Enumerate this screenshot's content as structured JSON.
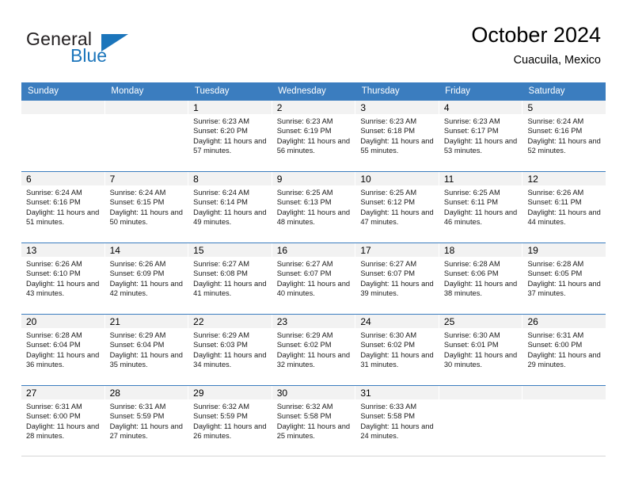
{
  "brand": {
    "name_top": "General",
    "name_bottom": "Blue",
    "triangle_icon": "blue-triangle-icon",
    "accent_color": "#1b75bb"
  },
  "header": {
    "title": "October 2024",
    "subtitle": "Cuacuila, Mexico"
  },
  "calendar": {
    "header_color": "#3b7dbf",
    "weekdays": [
      "Sunday",
      "Monday",
      "Tuesday",
      "Wednesday",
      "Thursday",
      "Friday",
      "Saturday"
    ],
    "labels": {
      "sunrise": "Sunrise:",
      "sunset": "Sunset:",
      "daylight": "Daylight:"
    },
    "weeks": [
      [
        {
          "day": "",
          "sunrise": "",
          "sunset": "",
          "daylight": ""
        },
        {
          "day": "",
          "sunrise": "",
          "sunset": "",
          "daylight": ""
        },
        {
          "day": "1",
          "sunrise": "Sunrise: 6:23 AM",
          "sunset": "Sunset: 6:20 PM",
          "daylight": "Daylight: 11 hours and 57 minutes."
        },
        {
          "day": "2",
          "sunrise": "Sunrise: 6:23 AM",
          "sunset": "Sunset: 6:19 PM",
          "daylight": "Daylight: 11 hours and 56 minutes."
        },
        {
          "day": "3",
          "sunrise": "Sunrise: 6:23 AM",
          "sunset": "Sunset: 6:18 PM",
          "daylight": "Daylight: 11 hours and 55 minutes."
        },
        {
          "day": "4",
          "sunrise": "Sunrise: 6:23 AM",
          "sunset": "Sunset: 6:17 PM",
          "daylight": "Daylight: 11 hours and 53 minutes."
        },
        {
          "day": "5",
          "sunrise": "Sunrise: 6:24 AM",
          "sunset": "Sunset: 6:16 PM",
          "daylight": "Daylight: 11 hours and 52 minutes."
        }
      ],
      [
        {
          "day": "6",
          "sunrise": "Sunrise: 6:24 AM",
          "sunset": "Sunset: 6:16 PM",
          "daylight": "Daylight: 11 hours and 51 minutes."
        },
        {
          "day": "7",
          "sunrise": "Sunrise: 6:24 AM",
          "sunset": "Sunset: 6:15 PM",
          "daylight": "Daylight: 11 hours and 50 minutes."
        },
        {
          "day": "8",
          "sunrise": "Sunrise: 6:24 AM",
          "sunset": "Sunset: 6:14 PM",
          "daylight": "Daylight: 11 hours and 49 minutes."
        },
        {
          "day": "9",
          "sunrise": "Sunrise: 6:25 AM",
          "sunset": "Sunset: 6:13 PM",
          "daylight": "Daylight: 11 hours and 48 minutes."
        },
        {
          "day": "10",
          "sunrise": "Sunrise: 6:25 AM",
          "sunset": "Sunset: 6:12 PM",
          "daylight": "Daylight: 11 hours and 47 minutes."
        },
        {
          "day": "11",
          "sunrise": "Sunrise: 6:25 AM",
          "sunset": "Sunset: 6:11 PM",
          "daylight": "Daylight: 11 hours and 46 minutes."
        },
        {
          "day": "12",
          "sunrise": "Sunrise: 6:26 AM",
          "sunset": "Sunset: 6:11 PM",
          "daylight": "Daylight: 11 hours and 44 minutes."
        }
      ],
      [
        {
          "day": "13",
          "sunrise": "Sunrise: 6:26 AM",
          "sunset": "Sunset: 6:10 PM",
          "daylight": "Daylight: 11 hours and 43 minutes."
        },
        {
          "day": "14",
          "sunrise": "Sunrise: 6:26 AM",
          "sunset": "Sunset: 6:09 PM",
          "daylight": "Daylight: 11 hours and 42 minutes."
        },
        {
          "day": "15",
          "sunrise": "Sunrise: 6:27 AM",
          "sunset": "Sunset: 6:08 PM",
          "daylight": "Daylight: 11 hours and 41 minutes."
        },
        {
          "day": "16",
          "sunrise": "Sunrise: 6:27 AM",
          "sunset": "Sunset: 6:07 PM",
          "daylight": "Daylight: 11 hours and 40 minutes."
        },
        {
          "day": "17",
          "sunrise": "Sunrise: 6:27 AM",
          "sunset": "Sunset: 6:07 PM",
          "daylight": "Daylight: 11 hours and 39 minutes."
        },
        {
          "day": "18",
          "sunrise": "Sunrise: 6:28 AM",
          "sunset": "Sunset: 6:06 PM",
          "daylight": "Daylight: 11 hours and 38 minutes."
        },
        {
          "day": "19",
          "sunrise": "Sunrise: 6:28 AM",
          "sunset": "Sunset: 6:05 PM",
          "daylight": "Daylight: 11 hours and 37 minutes."
        }
      ],
      [
        {
          "day": "20",
          "sunrise": "Sunrise: 6:28 AM",
          "sunset": "Sunset: 6:04 PM",
          "daylight": "Daylight: 11 hours and 36 minutes."
        },
        {
          "day": "21",
          "sunrise": "Sunrise: 6:29 AM",
          "sunset": "Sunset: 6:04 PM",
          "daylight": "Daylight: 11 hours and 35 minutes."
        },
        {
          "day": "22",
          "sunrise": "Sunrise: 6:29 AM",
          "sunset": "Sunset: 6:03 PM",
          "daylight": "Daylight: 11 hours and 34 minutes."
        },
        {
          "day": "23",
          "sunrise": "Sunrise: 6:29 AM",
          "sunset": "Sunset: 6:02 PM",
          "daylight": "Daylight: 11 hours and 32 minutes."
        },
        {
          "day": "24",
          "sunrise": "Sunrise: 6:30 AM",
          "sunset": "Sunset: 6:02 PM",
          "daylight": "Daylight: 11 hours and 31 minutes."
        },
        {
          "day": "25",
          "sunrise": "Sunrise: 6:30 AM",
          "sunset": "Sunset: 6:01 PM",
          "daylight": "Daylight: 11 hours and 30 minutes."
        },
        {
          "day": "26",
          "sunrise": "Sunrise: 6:31 AM",
          "sunset": "Sunset: 6:00 PM",
          "daylight": "Daylight: 11 hours and 29 minutes."
        }
      ],
      [
        {
          "day": "27",
          "sunrise": "Sunrise: 6:31 AM",
          "sunset": "Sunset: 6:00 PM",
          "daylight": "Daylight: 11 hours and 28 minutes."
        },
        {
          "day": "28",
          "sunrise": "Sunrise: 6:31 AM",
          "sunset": "Sunset: 5:59 PM",
          "daylight": "Daylight: 11 hours and 27 minutes."
        },
        {
          "day": "29",
          "sunrise": "Sunrise: 6:32 AM",
          "sunset": "Sunset: 5:59 PM",
          "daylight": "Daylight: 11 hours and 26 minutes."
        },
        {
          "day": "30",
          "sunrise": "Sunrise: 6:32 AM",
          "sunset": "Sunset: 5:58 PM",
          "daylight": "Daylight: 11 hours and 25 minutes."
        },
        {
          "day": "31",
          "sunrise": "Sunrise: 6:33 AM",
          "sunset": "Sunset: 5:58 PM",
          "daylight": "Daylight: 11 hours and 24 minutes."
        },
        {
          "day": "",
          "sunrise": "",
          "sunset": "",
          "daylight": ""
        },
        {
          "day": "",
          "sunrise": "",
          "sunset": "",
          "daylight": ""
        }
      ]
    ]
  }
}
